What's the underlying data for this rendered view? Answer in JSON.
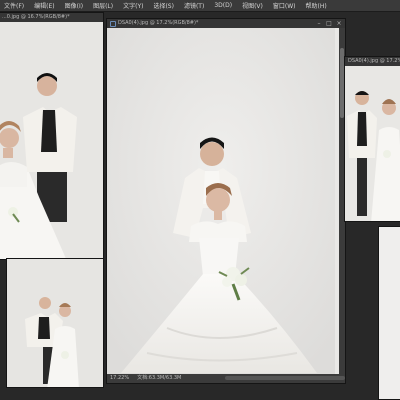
{
  "menubar": {
    "items": [
      "文件(F)",
      "编辑(E)",
      "图像(I)",
      "图层(L)",
      "文字(Y)",
      "选择(S)",
      "滤镜(T)",
      "3D(D)",
      "视图(V)",
      "窗口(W)",
      "帮助(H)"
    ]
  },
  "windows": {
    "main": {
      "title": "DSA0(4).jpg @ 17.2%(RGB/8#)*",
      "zoom": "17.22%",
      "doc": "文档:63.3M/63.3M"
    },
    "left_top": {
      "title": "...0.jpg @ 16.7%(RGB/8#)*"
    },
    "right_top": {
      "title": "DSA0(4).jpg @ 17.2% ..."
    }
  },
  "colors": {
    "menubar": "#3a3a3a",
    "workspace": "#282828",
    "titlebar": "#353535",
    "backdrop": "#e9e8e6",
    "dress": "#f7f6f3",
    "suit_white": "#f4f2ee",
    "vest_black": "#1e1e1e"
  },
  "icons": [
    "document-icon",
    "minimize-icon",
    "maximize-icon",
    "close-icon"
  ]
}
